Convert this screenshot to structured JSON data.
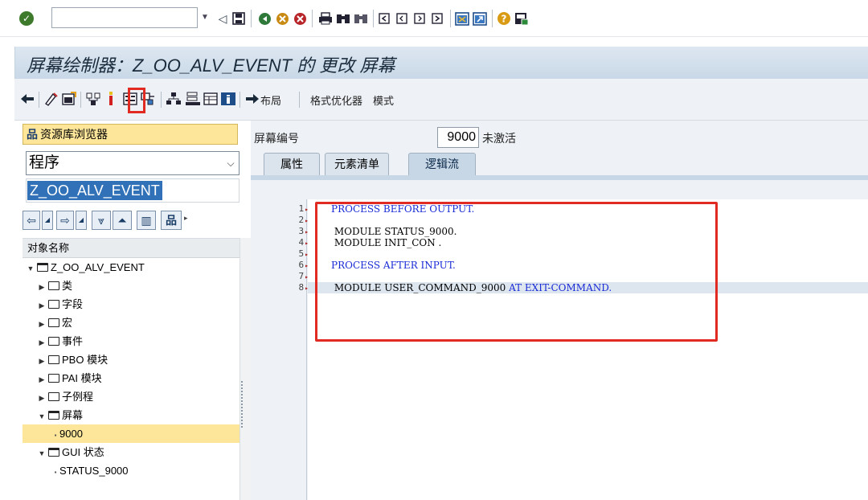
{
  "system_toolbar": {
    "command_value": "",
    "icons": [
      "ok-check-icon",
      "back-arrow-icon",
      "save-icon",
      "back-icon",
      "exit-icon",
      "cancel-icon",
      "print-icon",
      "find-icon",
      "find-next-icon",
      "first-page-icon",
      "prev-page-icon",
      "next-page-icon",
      "last-page-icon",
      "new-session-icon",
      "shortcut-icon",
      "help-icon",
      "customize-layout-icon"
    ]
  },
  "title": "屏幕绘制器：Z_OO_ALV_EVENT 的 更改 屏幕",
  "app_toolbar": {
    "layout_label": "布局",
    "format_label": "格式优化器",
    "mode_label": "模式"
  },
  "left_panel": {
    "repo_browser_label": "资源库浏览器",
    "object_type": "程序",
    "object_name": "Z_OO_ALV_EVENT",
    "tree_header": "对象名称",
    "tree": [
      {
        "label": "Z_OO_ALV_EVENT",
        "level": 0,
        "expanded": true,
        "kind": "folder"
      },
      {
        "label": "类",
        "level": 1,
        "expanded": false,
        "kind": "folder"
      },
      {
        "label": "字段",
        "level": 1,
        "expanded": false,
        "kind": "folder"
      },
      {
        "label": "宏",
        "level": 1,
        "expanded": false,
        "kind": "folder"
      },
      {
        "label": "事件",
        "level": 1,
        "expanded": false,
        "kind": "folder"
      },
      {
        "label": "PBO 模块",
        "level": 1,
        "expanded": false,
        "kind": "folder"
      },
      {
        "label": "PAI 模块",
        "level": 1,
        "expanded": false,
        "kind": "folder"
      },
      {
        "label": "子例程",
        "level": 1,
        "expanded": false,
        "kind": "folder"
      },
      {
        "label": "屏幕",
        "level": 1,
        "expanded": true,
        "kind": "folder"
      },
      {
        "label": "9000",
        "level": 2,
        "kind": "leaf",
        "selected": true
      },
      {
        "label": "GUI 状态",
        "level": 1,
        "expanded": true,
        "kind": "folder"
      },
      {
        "label": "STATUS_9000",
        "level": 2,
        "kind": "leaf"
      }
    ]
  },
  "right_panel": {
    "screen_no_label": "屏幕编号",
    "screen_no": "9000",
    "screen_status": "未激活",
    "tabs": [
      {
        "label": "属性",
        "active": false
      },
      {
        "label": "元素清单",
        "active": false
      },
      {
        "label": "逻辑流",
        "active": true
      }
    ],
    "code": [
      {
        "line": "1",
        "text": "PROCESS BEFORE OUTPUT.",
        "kind": "keyword"
      },
      {
        "line": "2",
        "text": "",
        "kind": "plain"
      },
      {
        "line": "3",
        "text": " MODULE STATUS_9000.",
        "kind": "plain"
      },
      {
        "line": "4",
        "text": " MODULE INIT_CON .",
        "kind": "plain"
      },
      {
        "line": "5",
        "text": "",
        "kind": "plain"
      },
      {
        "line": "6",
        "text": "PROCESS AFTER INPUT.",
        "kind": "keyword"
      },
      {
        "line": "7",
        "text": "",
        "kind": "plain"
      },
      {
        "line": "8",
        "text": " MODULE USER_COMMAND_9000 ",
        "suffix": "AT EXIT-COMMAND.",
        "kind": "mixed",
        "highlight": true
      }
    ]
  },
  "colors": {
    "keyword": "#1a2bd6",
    "selection": "#fde69a",
    "annotation_red": "#e02a22",
    "title_bg": "#c9d8e7"
  }
}
